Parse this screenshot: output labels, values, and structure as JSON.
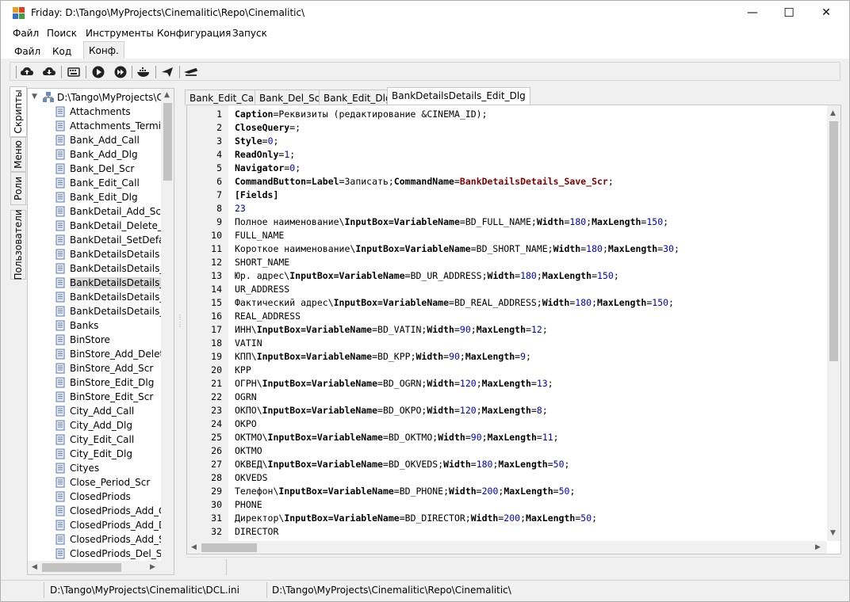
{
  "window": {
    "title": "Friday: D:\\Tango\\MyProjects\\Cinemalitic\\Repo\\Cinemalitic\\",
    "minimize": "—",
    "maximize": "☐",
    "close": "✕"
  },
  "menu": [
    "Файл",
    "Поиск",
    "Инструменты",
    "Конфигурация",
    "Запуск"
  ],
  "top_tabs": [
    "Файл",
    "Код",
    "Конф."
  ],
  "left_tabs": [
    "Скрипты",
    "Меню",
    "Роли",
    "Пользователи"
  ],
  "tree": {
    "root": "D:\\Tango\\MyProjects\\Ci",
    "items": [
      "Attachments",
      "Attachments_Termina",
      "Bank_Add_Call",
      "Bank_Add_Dlg",
      "Bank_Del_Scr",
      "Bank_Edit_Call",
      "Bank_Edit_Dlg",
      "BankDetail_Add_Scr",
      "BankDetail_Delete_Titl",
      "BankDetail_SetDefault",
      "BankDetailsDetails",
      "BankDetailsDetails_Co",
      "BankDetailsDetails_Edi",
      "BankDetailsDetails_Ed",
      "BankDetailsDetails_Sav",
      "Banks",
      "BinStore",
      "BinStore_Add_Delete",
      "BinStore_Add_Scr",
      "BinStore_Edit_Dlg",
      "BinStore_Edit_Scr",
      "City_Add_Call",
      "City_Add_Dlg",
      "City_Edit_Call",
      "City_Edit_Dlg",
      "Cityes",
      "Close_Period_Scr",
      "ClosedPriods",
      "ClosedPriods_Add_Ca",
      "ClosedPriods_Add_Dlg",
      "ClosedPriods_Add_Sc",
      "ClosedPriods_Del_Scr"
    ]
  },
  "doc_tabs": [
    "Bank_Edit_Call",
    "Bank_Del_Scr",
    "Bank_Edit_Dlg",
    "BankDetailsDetails_Edit_Dlg"
  ],
  "code_lines": [
    {
      "n": "1",
      "parts": [
        [
          "kw",
          "Caption"
        ],
        [
          "t",
          "=Реквизиты (редактирование &CINEMA_ID);"
        ]
      ]
    },
    {
      "n": "2",
      "parts": [
        [
          "kw",
          "CloseQuery"
        ],
        [
          "t",
          "=;"
        ]
      ]
    },
    {
      "n": "3",
      "parts": [
        [
          "kw",
          "Style"
        ],
        [
          "t",
          "="
        ],
        [
          "num",
          "0"
        ],
        [
          "t",
          ";"
        ]
      ]
    },
    {
      "n": "4",
      "parts": [
        [
          "kw",
          "ReadOnly"
        ],
        [
          "t",
          "="
        ],
        [
          "num",
          "1"
        ],
        [
          "t",
          ";"
        ]
      ]
    },
    {
      "n": "5",
      "parts": [
        [
          "kw",
          "Navigator"
        ],
        [
          "t",
          "="
        ],
        [
          "num",
          "0"
        ],
        [
          "t",
          ";"
        ]
      ]
    },
    {
      "n": "6",
      "parts": [
        [
          "kw",
          "CommandButton=Label"
        ],
        [
          "t",
          "=Записать;"
        ],
        [
          "kw",
          "CommandName"
        ],
        [
          "t",
          "="
        ],
        [
          "str",
          "BankDetailsDetails_Save_Scr"
        ],
        [
          "t",
          ";"
        ]
      ]
    },
    {
      "n": "7",
      "parts": [
        [
          "kw",
          "[Fields]"
        ]
      ]
    },
    {
      "n": "8",
      "parts": [
        [
          "num",
          "23"
        ]
      ]
    },
    {
      "n": "9",
      "parts": [
        [
          "t",
          "Полное наименование\\"
        ],
        [
          "kw",
          "InputBox=VariableName"
        ],
        [
          "t",
          "=BD_FULL_NAME;"
        ],
        [
          "kw",
          "Width"
        ],
        [
          "t",
          "="
        ],
        [
          "num",
          "180"
        ],
        [
          "t",
          ";"
        ],
        [
          "kw",
          "MaxLength"
        ],
        [
          "t",
          "="
        ],
        [
          "num",
          "150"
        ],
        [
          "t",
          ";"
        ]
      ]
    },
    {
      "n": "10",
      "parts": [
        [
          "t",
          "FULL_NAME"
        ]
      ]
    },
    {
      "n": "11",
      "parts": [
        [
          "t",
          "Короткое наименование\\"
        ],
        [
          "kw",
          "InputBox=VariableName"
        ],
        [
          "t",
          "=BD_SHORT_NAME;"
        ],
        [
          "kw",
          "Width"
        ],
        [
          "t",
          "="
        ],
        [
          "num",
          "180"
        ],
        [
          "t",
          ";"
        ],
        [
          "kw",
          "MaxLength"
        ],
        [
          "t",
          "="
        ],
        [
          "num",
          "30"
        ],
        [
          "t",
          ";"
        ]
      ]
    },
    {
      "n": "12",
      "parts": [
        [
          "t",
          "SHORT_NAME"
        ]
      ]
    },
    {
      "n": "13",
      "parts": [
        [
          "t",
          "Юр. адрес\\"
        ],
        [
          "kw",
          "InputBox=VariableName"
        ],
        [
          "t",
          "=BD_UR_ADDRESS;"
        ],
        [
          "kw",
          "Width"
        ],
        [
          "t",
          "="
        ],
        [
          "num",
          "180"
        ],
        [
          "t",
          ";"
        ],
        [
          "kw",
          "MaxLength"
        ],
        [
          "t",
          "="
        ],
        [
          "num",
          "150"
        ],
        [
          "t",
          ";"
        ]
      ]
    },
    {
      "n": "14",
      "parts": [
        [
          "t",
          "UR_ADDRESS"
        ]
      ]
    },
    {
      "n": "15",
      "parts": [
        [
          "t",
          "Фактический адрес\\"
        ],
        [
          "kw",
          "InputBox=VariableName"
        ],
        [
          "t",
          "=BD_REAL_ADDRESS;"
        ],
        [
          "kw",
          "Width"
        ],
        [
          "t",
          "="
        ],
        [
          "num",
          "180"
        ],
        [
          "t",
          ";"
        ],
        [
          "kw",
          "MaxLength"
        ],
        [
          "t",
          "="
        ],
        [
          "num",
          "150"
        ],
        [
          "t",
          ";"
        ]
      ]
    },
    {
      "n": "16",
      "parts": [
        [
          "t",
          "REAL_ADDRESS"
        ]
      ]
    },
    {
      "n": "17",
      "parts": [
        [
          "t",
          "ИНН\\"
        ],
        [
          "kw",
          "InputBox=VariableName"
        ],
        [
          "t",
          "=BD_VATIN;"
        ],
        [
          "kw",
          "Width"
        ],
        [
          "t",
          "="
        ],
        [
          "num",
          "90"
        ],
        [
          "t",
          ";"
        ],
        [
          "kw",
          "MaxLength"
        ],
        [
          "t",
          "="
        ],
        [
          "num",
          "12"
        ],
        [
          "t",
          ";"
        ]
      ]
    },
    {
      "n": "18",
      "parts": [
        [
          "t",
          "VATIN"
        ]
      ]
    },
    {
      "n": "19",
      "parts": [
        [
          "t",
          "КПП\\"
        ],
        [
          "kw",
          "InputBox=VariableName"
        ],
        [
          "t",
          "=BD_KPP;"
        ],
        [
          "kw",
          "Width"
        ],
        [
          "t",
          "="
        ],
        [
          "num",
          "90"
        ],
        [
          "t",
          ";"
        ],
        [
          "kw",
          "MaxLength"
        ],
        [
          "t",
          "="
        ],
        [
          "num",
          "9"
        ],
        [
          "t",
          ";"
        ]
      ]
    },
    {
      "n": "20",
      "parts": [
        [
          "t",
          "KPP"
        ]
      ]
    },
    {
      "n": "21",
      "parts": [
        [
          "t",
          "ОГРН\\"
        ],
        [
          "kw",
          "InputBox=VariableName"
        ],
        [
          "t",
          "=BD_OGRN;"
        ],
        [
          "kw",
          "Width"
        ],
        [
          "t",
          "="
        ],
        [
          "num",
          "120"
        ],
        [
          "t",
          ";"
        ],
        [
          "kw",
          "MaxLength"
        ],
        [
          "t",
          "="
        ],
        [
          "num",
          "13"
        ],
        [
          "t",
          ";"
        ]
      ]
    },
    {
      "n": "22",
      "parts": [
        [
          "t",
          "OGRN"
        ]
      ]
    },
    {
      "n": "23",
      "parts": [
        [
          "t",
          "ОКПО\\"
        ],
        [
          "kw",
          "InputBox=VariableName"
        ],
        [
          "t",
          "=BD_OKPO;"
        ],
        [
          "kw",
          "Width"
        ],
        [
          "t",
          "="
        ],
        [
          "num",
          "120"
        ],
        [
          "t",
          ";"
        ],
        [
          "kw",
          "MaxLength"
        ],
        [
          "t",
          "="
        ],
        [
          "num",
          "8"
        ],
        [
          "t",
          ";"
        ]
      ]
    },
    {
      "n": "24",
      "parts": [
        [
          "t",
          "OKPO"
        ]
      ]
    },
    {
      "n": "25",
      "parts": [
        [
          "t",
          "ОКТМО\\"
        ],
        [
          "kw",
          "InputBox=VariableName"
        ],
        [
          "t",
          "=BD_OKTMO;"
        ],
        [
          "kw",
          "Width"
        ],
        [
          "t",
          "="
        ],
        [
          "num",
          "90"
        ],
        [
          "t",
          ";"
        ],
        [
          "kw",
          "MaxLength"
        ],
        [
          "t",
          "="
        ],
        [
          "num",
          "11"
        ],
        [
          "t",
          ";"
        ]
      ]
    },
    {
      "n": "26",
      "parts": [
        [
          "t",
          "OKTMO"
        ]
      ]
    },
    {
      "n": "27",
      "parts": [
        [
          "t",
          "ОКВЕД\\"
        ],
        [
          "kw",
          "InputBox=VariableName"
        ],
        [
          "t",
          "=BD_OKVEDS;"
        ],
        [
          "kw",
          "Width"
        ],
        [
          "t",
          "="
        ],
        [
          "num",
          "180"
        ],
        [
          "t",
          ";"
        ],
        [
          "kw",
          "MaxLength"
        ],
        [
          "t",
          "="
        ],
        [
          "num",
          "50"
        ],
        [
          "t",
          ";"
        ]
      ]
    },
    {
      "n": "28",
      "parts": [
        [
          "t",
          "OKVEDS"
        ]
      ]
    },
    {
      "n": "29",
      "parts": [
        [
          "t",
          "Телефон\\"
        ],
        [
          "kw",
          "InputBox=VariableName"
        ],
        [
          "t",
          "=BD_PHONE;"
        ],
        [
          "kw",
          "Width"
        ],
        [
          "t",
          "="
        ],
        [
          "num",
          "200"
        ],
        [
          "t",
          ";"
        ],
        [
          "kw",
          "MaxLength"
        ],
        [
          "t",
          "="
        ],
        [
          "num",
          "50"
        ],
        [
          "t",
          ";"
        ]
      ]
    },
    {
      "n": "30",
      "parts": [
        [
          "t",
          "PHONE"
        ]
      ]
    },
    {
      "n": "31",
      "parts": [
        [
          "t",
          "Директор\\"
        ],
        [
          "kw",
          "InputBox=VariableName"
        ],
        [
          "t",
          "=BD_DIRECTOR;"
        ],
        [
          "kw",
          "Width"
        ],
        [
          "t",
          "="
        ],
        [
          "num",
          "200"
        ],
        [
          "t",
          ";"
        ],
        [
          "kw",
          "MaxLength"
        ],
        [
          "t",
          "="
        ],
        [
          "num",
          "50"
        ],
        [
          "t",
          ";"
        ]
      ]
    },
    {
      "n": "32",
      "parts": [
        [
          "t",
          "DIRECTOR"
        ]
      ]
    }
  ],
  "status": {
    "ini_path": "D:\\Tango\\MyProjects\\Cinemalitic\\DCL.ini",
    "repo_path": "D:\\Tango\\MyProjects\\Cinemalitic\\Repo\\Cinemalitic\\"
  },
  "colors": {
    "keyword": "#000000",
    "number": "#0000c0",
    "string": "#800000"
  }
}
